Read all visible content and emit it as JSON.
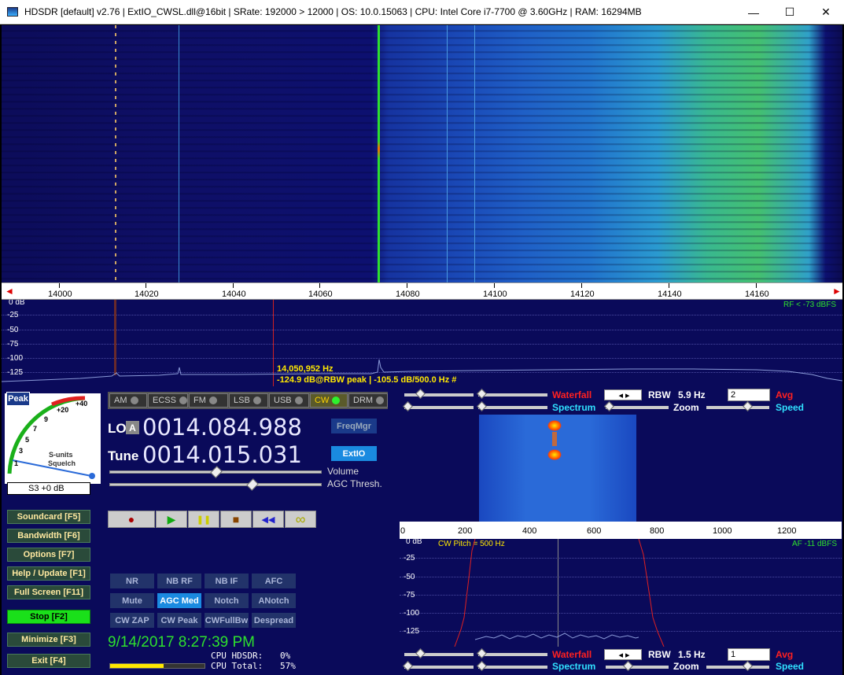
{
  "window": {
    "title": "HDSDR  [default]  v2.76   |  ExtIO_CWSL.dll@16bit  |  SRate: 192000 > 12000  |  OS: 10.0.15063   |  CPU: Intel Core i7-7700 @ 3.60GHz  |  RAM: 16294MB",
    "minimize": "—",
    "maximize": "☐",
    "close": "✕"
  },
  "freq_scale": {
    "labels": [
      "14000",
      "14020",
      "14040",
      "14060",
      "14080",
      "14100",
      "14120",
      "14140",
      "14160"
    ],
    "left_arrow": "◄",
    "right_arrow": "►"
  },
  "spectrum": {
    "db_labels": [
      "0 dB",
      "-25",
      "-50",
      "-75",
      "-100",
      "-125"
    ],
    "rf_level": "RF < -73 dBFS",
    "cursor_freq": "14,050,952 Hz",
    "cursor_info": "-124.9 dB@RBW peak  |  -105.5 dB/500.0 Hz #"
  },
  "smeter": {
    "peak_label": "Peak",
    "scale_labels": [
      "+40",
      "+20",
      "9",
      "7",
      "5",
      "3",
      "1"
    ],
    "center_text": "S-units",
    "squelch_text": "Squelch",
    "readout": "S3 +0 dB"
  },
  "side_buttons": [
    {
      "label": "Soundcard  [F5]"
    },
    {
      "label": "Bandwidth  [F6]"
    },
    {
      "label": "Options  [F7]"
    },
    {
      "label": "Help / Update  [F1]"
    },
    {
      "label": "Full Screen  [F11]"
    },
    {
      "label": "Stop  [F2]"
    },
    {
      "label": "Minimize  [F3]"
    },
    {
      "label": "Exit  [F4]"
    }
  ],
  "modes": [
    "AM",
    "ECSS",
    "FM",
    "LSB",
    "USB",
    "CW",
    "DRM"
  ],
  "lo": {
    "label": "LO",
    "a_badge": "A",
    "value": "0014.084.988"
  },
  "tune": {
    "label": "Tune",
    "value": "0014.015.031"
  },
  "freqmgr_label": "FreqMgr",
  "extio_label": "ExtIO",
  "volume_label": "Volume",
  "agc_label": "AGC Thresh.",
  "transport": {
    "record": "●",
    "play": "▶",
    "pause": "❚❚",
    "stop": "■",
    "rewind": "◀◀",
    "loop": "∞"
  },
  "dsp_buttons": [
    [
      "NR",
      "NB RF",
      "NB IF",
      "AFC"
    ],
    [
      "Mute",
      "AGC Med",
      "Notch",
      "ANotch"
    ],
    [
      "CW ZAP",
      "CW Peak",
      "CWFullBw",
      "Despread"
    ]
  ],
  "datetime": "9/14/2017 8:27:39 PM",
  "cpu": {
    "hdsdr_label": "CPU HDSDR:",
    "hdsdr_value": "0%",
    "total_label": "CPU Total:",
    "total_value": "57%",
    "total_fraction": 0.57
  },
  "top_controls": {
    "waterfall_label": "Waterfall",
    "spectrum_label": "Spectrum",
    "rbw_label": "RBW",
    "rbw_value": "5.9 Hz",
    "zoom_label": "Zoom",
    "avg_label": "Avg",
    "avg_value": "2",
    "speed_label": "Speed"
  },
  "audio_scale": {
    "labels": [
      "0",
      "200",
      "400",
      "600",
      "800",
      "1000",
      "1200"
    ]
  },
  "audio_spectrum": {
    "db_labels": [
      "0 dB",
      "-25",
      "-50",
      "-75",
      "-100",
      "-125"
    ],
    "cw_pitch": "CW Pitch = 500 Hz",
    "af_level": "AF -11 dBFS"
  },
  "bottom_controls": {
    "waterfall_label": "Waterfall",
    "spectrum_label": "Spectrum",
    "rbw_label": "RBW",
    "rbw_value": "1.5 Hz",
    "zoom_label": "Zoom",
    "avg_label": "Avg",
    "avg_value": "1",
    "speed_label": "Speed"
  },
  "colors": {
    "waterfall_bg": "#0d1070",
    "spectrum_bg": "#0a0a5a",
    "accent_red": "#ff2020",
    "accent_cyan": "#30e0ff",
    "cw_active": "#ffd400",
    "clock_green": "#2ee02e"
  }
}
